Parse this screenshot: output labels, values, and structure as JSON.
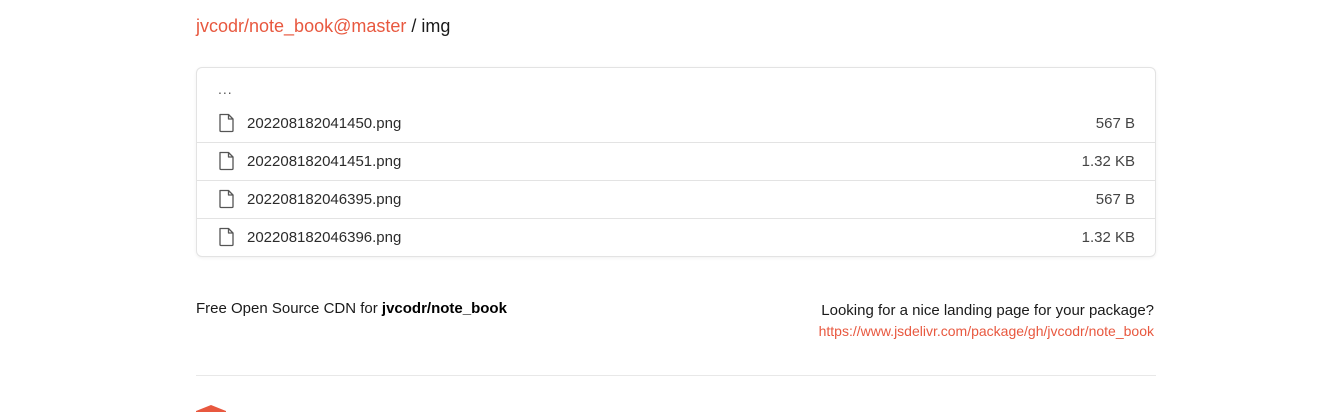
{
  "breadcrumb": {
    "repo": "jvcodr/note_book@master",
    "separator": "/",
    "current": "img"
  },
  "file_list": {
    "parent_label": "...",
    "files": [
      {
        "name": "202208182041450.png",
        "size": "567 B",
        "icon": "file-icon"
      },
      {
        "name": "202208182041451.png",
        "size": "1.32 KB",
        "icon": "file-icon"
      },
      {
        "name": "202208182046395.png",
        "size": "567 B",
        "icon": "file-icon"
      },
      {
        "name": "202208182046396.png",
        "size": "1.32 KB",
        "icon": "file-icon"
      }
    ]
  },
  "footer": {
    "cdn_prefix": "Free Open Source CDN for ",
    "cdn_repo": "jvcodr/note_book",
    "landing_question": "Looking for a nice landing page for your package?",
    "landing_url": "https://www.jsdelivr.com/package/gh/jvcodr/note_book"
  },
  "colors": {
    "accent": "#e8583f",
    "border": "#e3e3e3"
  }
}
